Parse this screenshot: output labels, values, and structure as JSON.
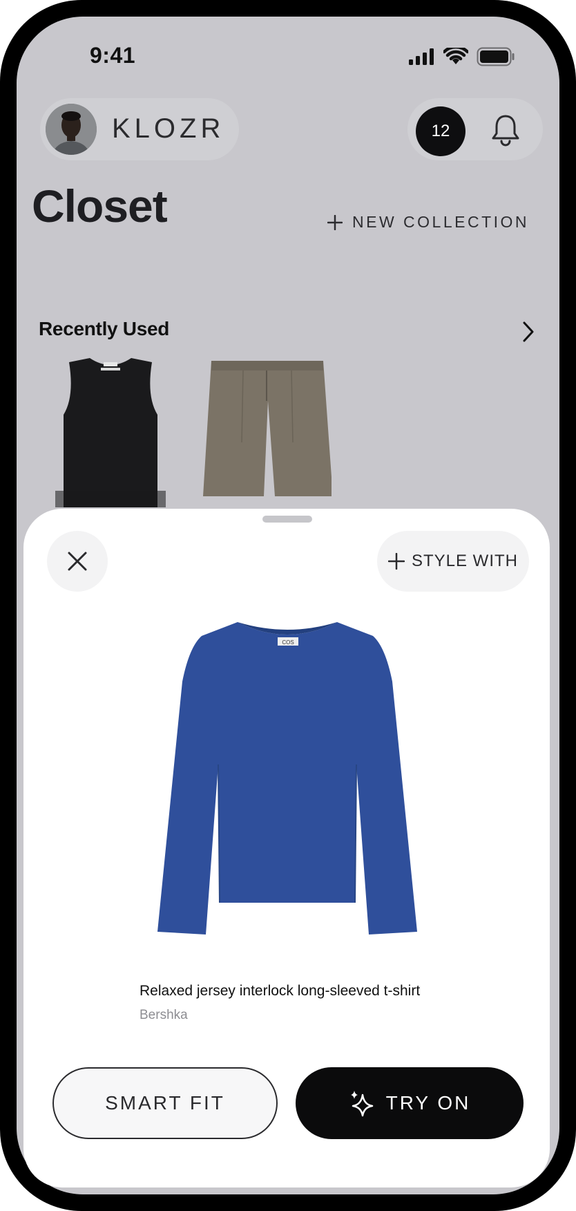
{
  "status_bar": {
    "time": "9:41"
  },
  "header": {
    "brand": "KLOZR",
    "notification_count": "12"
  },
  "page": {
    "title": "Closet",
    "new_collection_label": "NEW COLLECTION"
  },
  "recent": {
    "title": "Recently Used",
    "items": [
      {
        "name": "tank-top",
        "color": "#1a1a1c"
      },
      {
        "name": "shorts",
        "color": "#7b7366"
      }
    ]
  },
  "sheet": {
    "style_with_label": "STYLE WITH",
    "product": {
      "name": "Relaxed jersey interlock long-sleeved t-shirt",
      "brand": "Bershka",
      "label_text": "COS",
      "color": "#2f4f9b"
    },
    "smart_fit_label": "SMART FIT",
    "try_on_label": "TRY ON"
  },
  "colors": {
    "background": "#c8c7cc",
    "sheet": "#ffffff",
    "primary_button": "#0b0b0c",
    "accent_text": "#1e1e22"
  },
  "icons": [
    "signal-icon",
    "wifi-icon",
    "battery-icon",
    "bell-icon",
    "plus-icon",
    "chevron-right-icon",
    "close-icon",
    "sparkle-icon"
  ]
}
